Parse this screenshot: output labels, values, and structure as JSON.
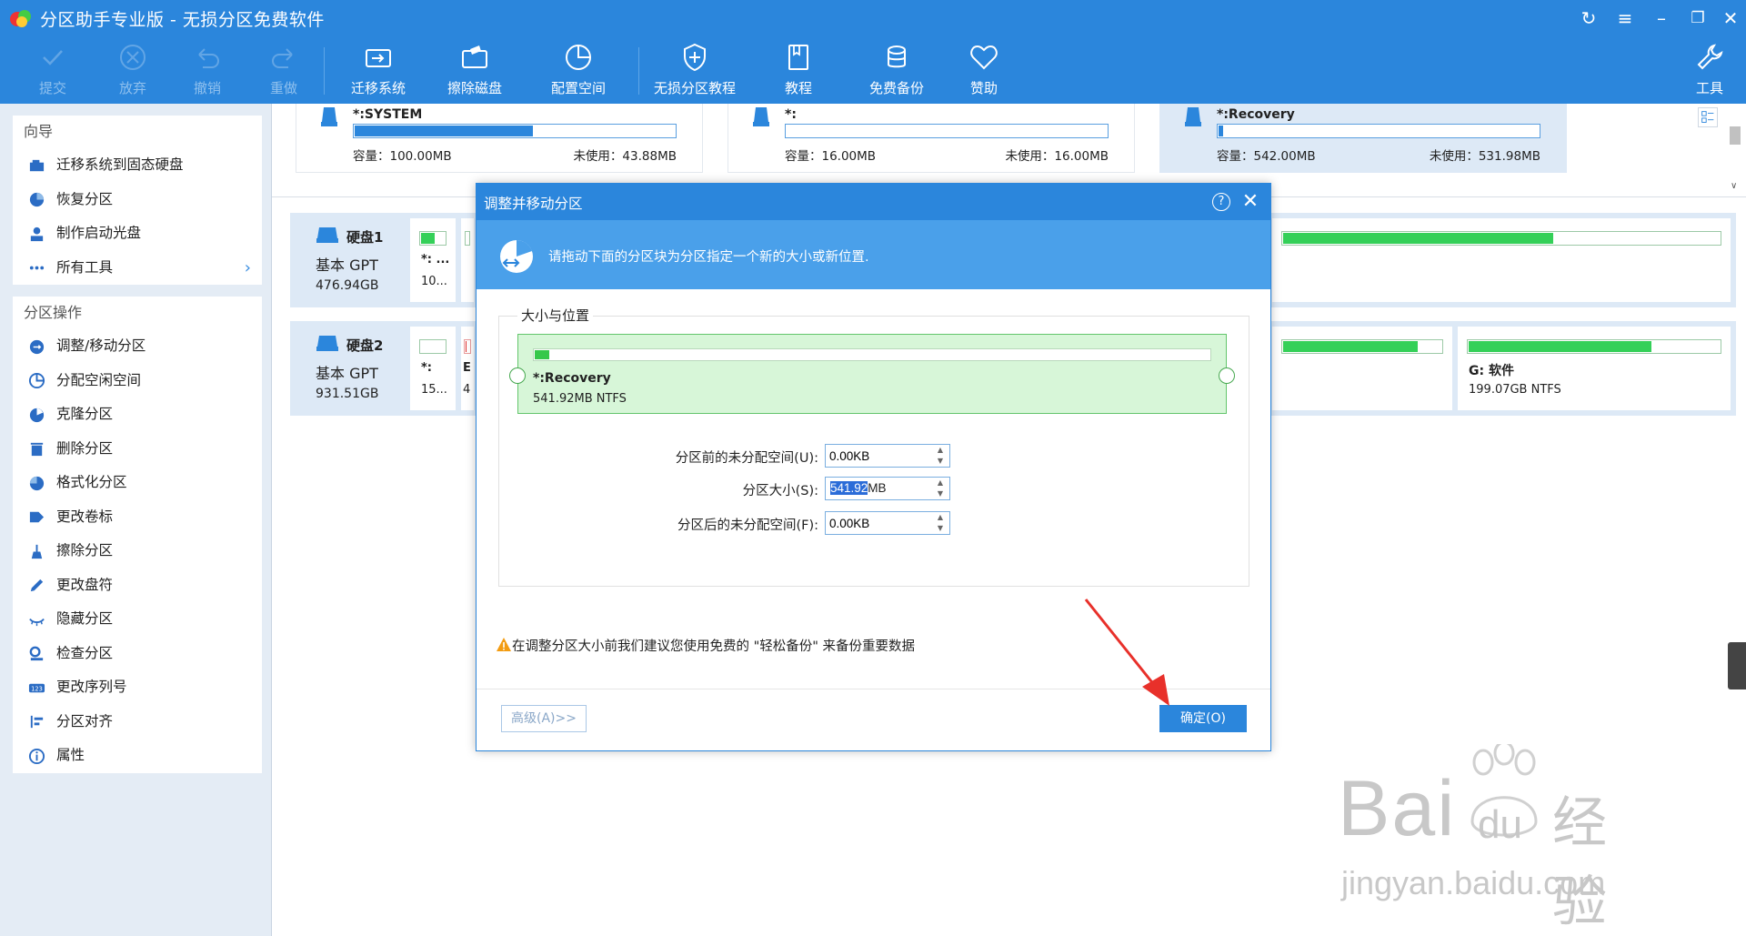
{
  "titlebar": {
    "title": "分区助手专业版 - 无损分区免费软件"
  },
  "toolbar": {
    "items": [
      {
        "label": "提交",
        "icon": "check-icon",
        "enabled": false
      },
      {
        "label": "放弃",
        "icon": "cancel-circle-icon",
        "enabled": false
      },
      {
        "label": "撤销",
        "icon": "undo-icon",
        "enabled": false
      },
      {
        "label": "重做",
        "icon": "redo-icon",
        "enabled": false
      },
      {
        "label": "迁移系统",
        "icon": "migrate-disk-icon",
        "enabled": true
      },
      {
        "label": "擦除磁盘",
        "icon": "wipe-disk-icon",
        "enabled": true
      },
      {
        "label": "配置空间",
        "icon": "pie-chart-icon",
        "enabled": true
      },
      {
        "label": "无损分区教程",
        "icon": "shield-plus-icon",
        "enabled": true
      },
      {
        "label": "教程",
        "icon": "book-icon",
        "enabled": true
      },
      {
        "label": "免费备份",
        "icon": "backup-icon",
        "enabled": true
      },
      {
        "label": "赞助",
        "icon": "heart-icon",
        "enabled": true
      },
      {
        "label": "工具",
        "icon": "wrench-icon",
        "enabled": true
      }
    ]
  },
  "sidebar": {
    "wizard_title": "向导",
    "wizard_items": [
      {
        "label": "迁移系统到固态硬盘",
        "icon": "ssd-icon"
      },
      {
        "label": "恢复分区",
        "icon": "recover-icon"
      },
      {
        "label": "制作启动光盘",
        "icon": "boot-disc-icon"
      },
      {
        "label": "所有工具",
        "icon": "dots-icon"
      }
    ],
    "ops_title": "分区操作",
    "ops_items": [
      {
        "label": "调整/移动分区",
        "icon": "resize-icon"
      },
      {
        "label": "分配空闲空间",
        "icon": "allocate-icon"
      },
      {
        "label": "克隆分区",
        "icon": "clone-icon"
      },
      {
        "label": "删除分区",
        "icon": "trash-icon"
      },
      {
        "label": "格式化分区",
        "icon": "format-icon"
      },
      {
        "label": "更改卷标",
        "icon": "tag-icon"
      },
      {
        "label": "擦除分区",
        "icon": "broom-icon"
      },
      {
        "label": "更改盘符",
        "icon": "pencil-icon"
      },
      {
        "label": "隐藏分区",
        "icon": "eye-closed-icon"
      },
      {
        "label": "检查分区",
        "icon": "check-disk-icon"
      },
      {
        "label": "更改序列号",
        "icon": "serial-icon"
      },
      {
        "label": "分区对齐",
        "icon": "align-icon"
      },
      {
        "label": "属性",
        "icon": "info-icon"
      }
    ]
  },
  "partitions_top": [
    {
      "name": "*:SYSTEM",
      "capacity": "容量：100.00MB",
      "free": "未使用：43.88MB",
      "used_fraction": 0.56,
      "selected": false
    },
    {
      "name": "*:",
      "capacity": "容量：16.00MB",
      "free": "未使用：16.00MB",
      "used_fraction": 0.0,
      "selected": false
    },
    {
      "name": "*:Recovery",
      "capacity": "容量：542.00MB",
      "free": "未使用：531.98MB",
      "used_fraction": 0.02,
      "selected": true
    }
  ],
  "disks": [
    {
      "name": "硬盘1",
      "type": "基本 GPT",
      "size": "476.94GB",
      "blocks": [
        {
          "line1": "*: ...",
          "line2": "10...",
          "fill": 0.6,
          "color": "#34d058"
        },
        {
          "line1": "",
          "line2": "",
          "fill": 0.0,
          "color": "#34d058"
        },
        {
          "line1": "",
          "line2": "",
          "fill": 0.62,
          "color": "#34d058"
        }
      ]
    },
    {
      "name": "硬盘2",
      "type": "基本 GPT",
      "size": "931.51GB",
      "blocks": [
        {
          "line1": "*:",
          "line2": "15...",
          "fill": 0.0,
          "color": "#34d058"
        },
        {
          "line1": "E",
          "line2": "4",
          "fill": 0.5,
          "color": "#e03030"
        },
        {
          "line1": "",
          "line2": "",
          "fill": 0.85,
          "color": "#34d058"
        },
        {
          "line1": "G: 软件",
          "line2": "199.07GB NTFS",
          "fill": 0.73,
          "color": "#34d058"
        }
      ]
    }
  ],
  "dialog": {
    "title": "调整并移动分区",
    "help_label": "?",
    "banner_text": "请拖动下面的分区块为分区指定一个新的大小或新位置.",
    "group_title": "大小与位置",
    "partition_name": "*:Recovery",
    "partition_info": "541.92MB NTFS",
    "partition_fill": 0.02,
    "fields": [
      {
        "label": "分区前的未分配空间(U):",
        "value": "0.00KB"
      },
      {
        "label": "分区大小(S):",
        "value_selected": "541.92",
        "value_rest": "MB"
      },
      {
        "label": "分区后的未分配空间(F):",
        "value": "0.00KB"
      }
    ],
    "warning": "在调整分区大小前我们建议您使用免费的 \"轻松备份\" 来备份重要数据",
    "advanced_label": "高级(A)>>",
    "ok_label": "确定(O)"
  },
  "watermark": {
    "main": "Bai",
    "paw": "du",
    "cn": "经验",
    "sub": "jingyan.baidu.com"
  },
  "colors": {
    "accent": "#2b86dc",
    "banner": "#4aa0ea",
    "sidebar_bg": "#e4ecf5",
    "selected_bg": "#dde9f6",
    "used_green": "#34d058",
    "arrow_red": "#e8302a"
  }
}
